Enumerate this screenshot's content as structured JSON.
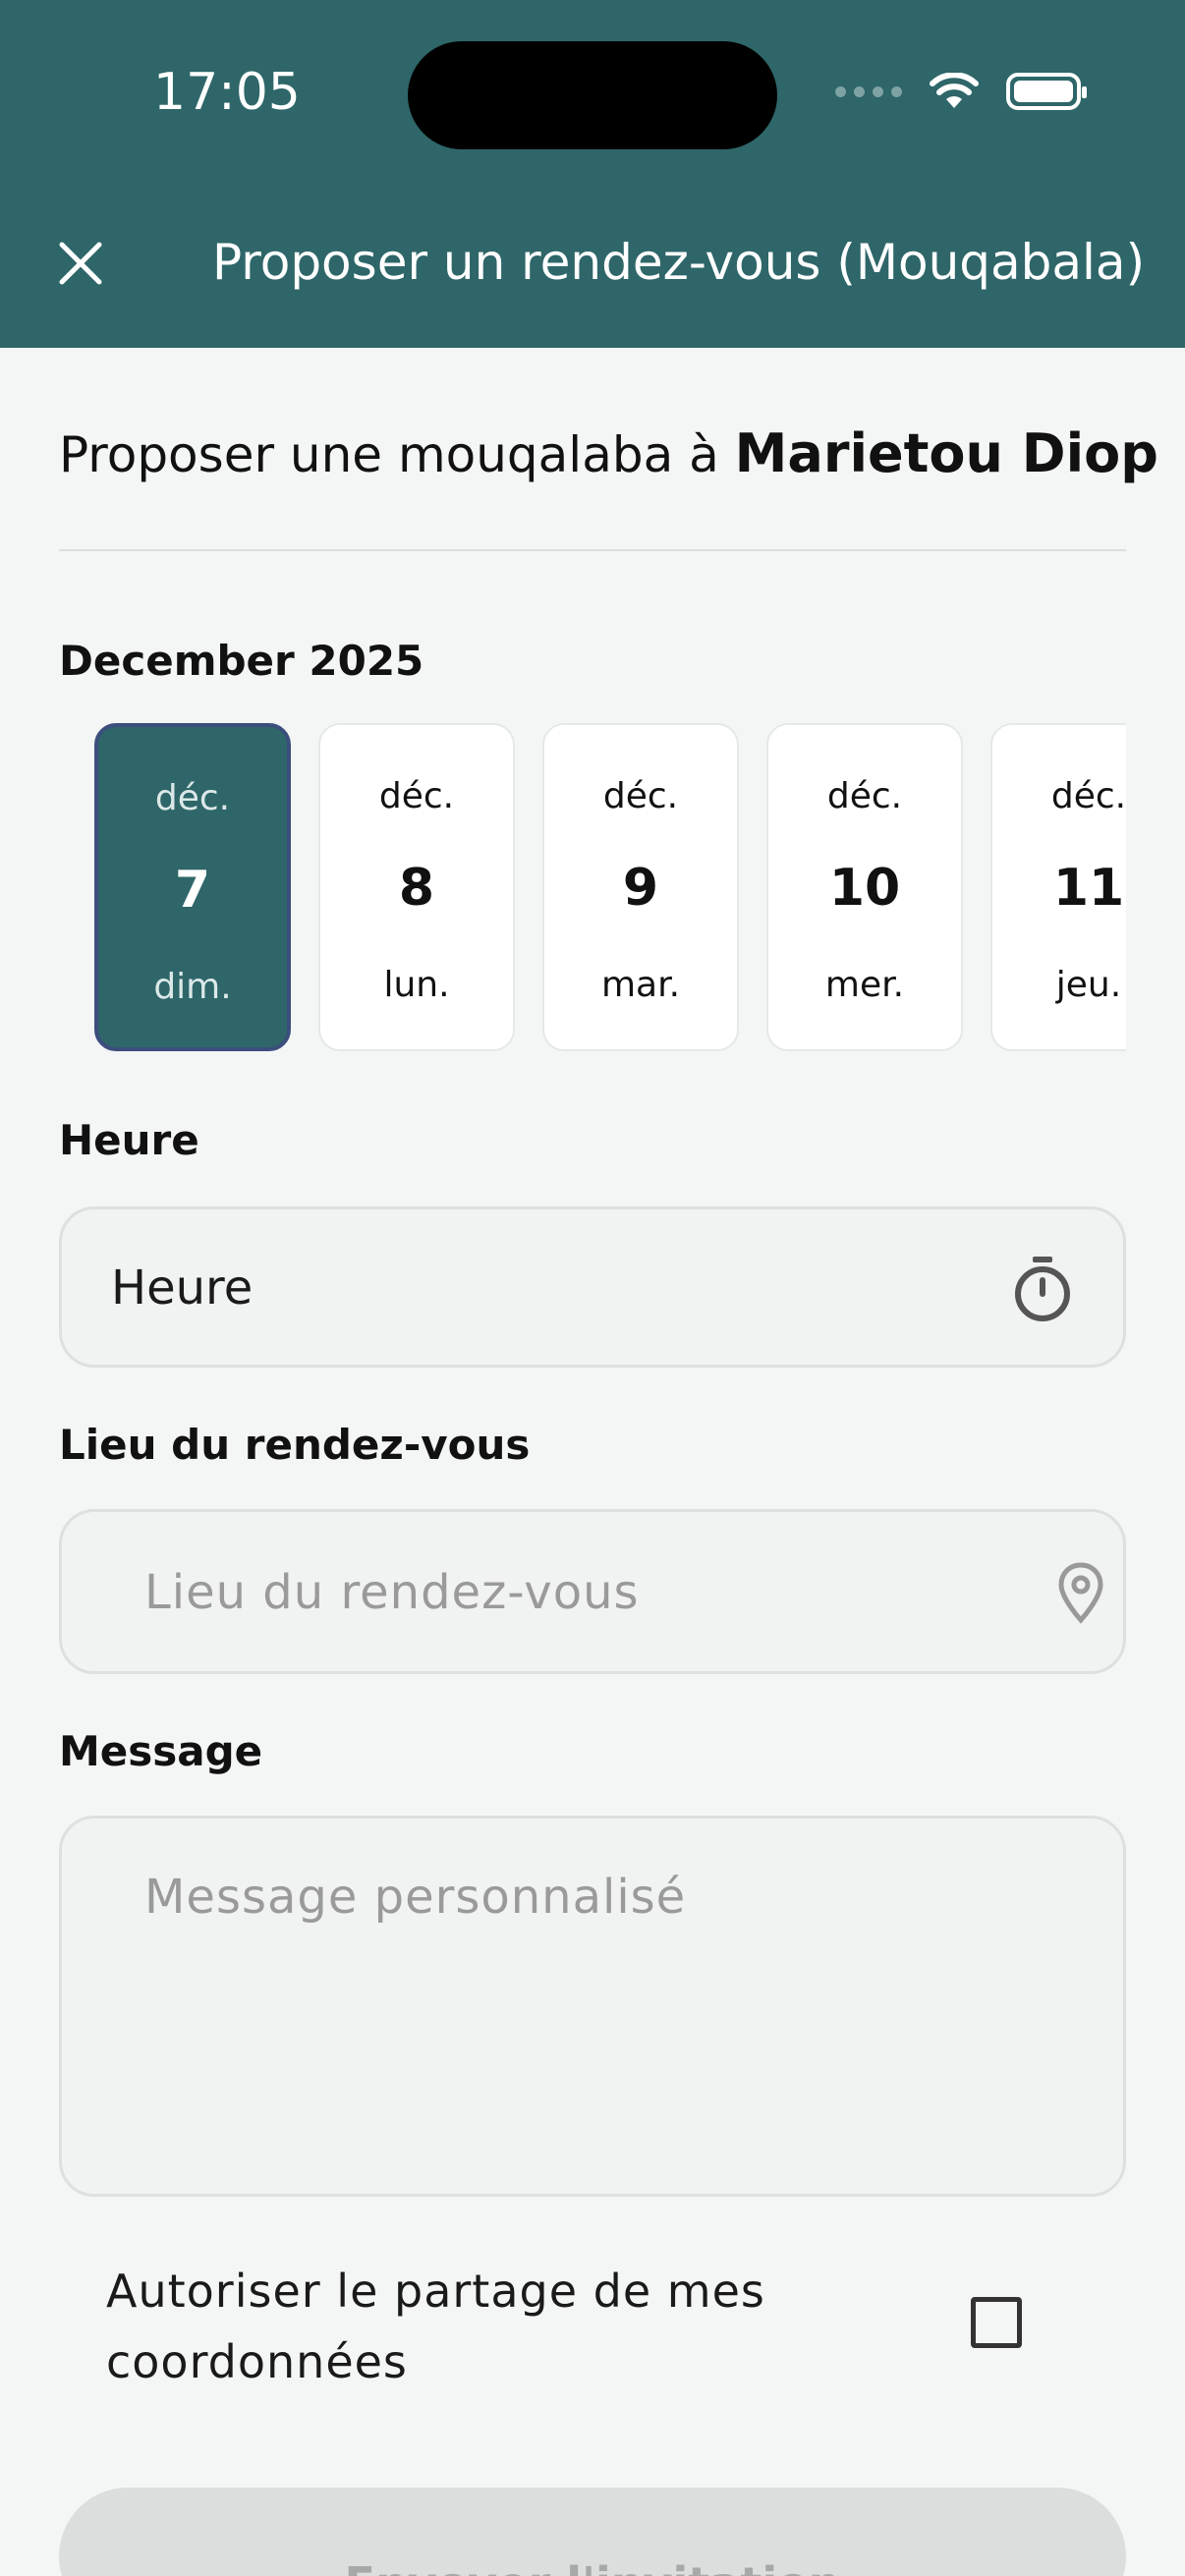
{
  "status_bar": {
    "time": "17:05"
  },
  "header": {
    "title": "Proposer un rendez-vous (Mouqabala)",
    "close_icon": "close-icon"
  },
  "intro": {
    "prefix": "Proposer une mouqalaba à",
    "name": "Marietou Diop"
  },
  "calendar": {
    "month_label": "December 2025",
    "days": [
      {
        "month": "déc.",
        "day": "7",
        "weekday": "dim.",
        "selected": true
      },
      {
        "month": "déc.",
        "day": "8",
        "weekday": "lun.",
        "selected": false
      },
      {
        "month": "déc.",
        "day": "9",
        "weekday": "mar.",
        "selected": false
      },
      {
        "month": "déc.",
        "day": "10",
        "weekday": "mer.",
        "selected": false
      },
      {
        "month": "déc.",
        "day": "11",
        "weekday": "jeu.",
        "selected": false
      }
    ]
  },
  "time_field": {
    "label": "Heure",
    "value": "Heure",
    "icon": "timer-icon"
  },
  "location_field": {
    "label": "Lieu du rendez-vous",
    "placeholder": "Lieu du rendez-vous",
    "icon": "location-pin-icon"
  },
  "message_field": {
    "label": "Message",
    "placeholder": "Message personnalisé"
  },
  "share": {
    "label": "Autoriser le partage de mes coordonnées",
    "checked": false
  },
  "submit": {
    "label": "Envoyer l'invitation"
  },
  "colors": {
    "primary": "#2E6669",
    "selected_border": "#3C4E7C",
    "background": "#F4F6F6"
  }
}
